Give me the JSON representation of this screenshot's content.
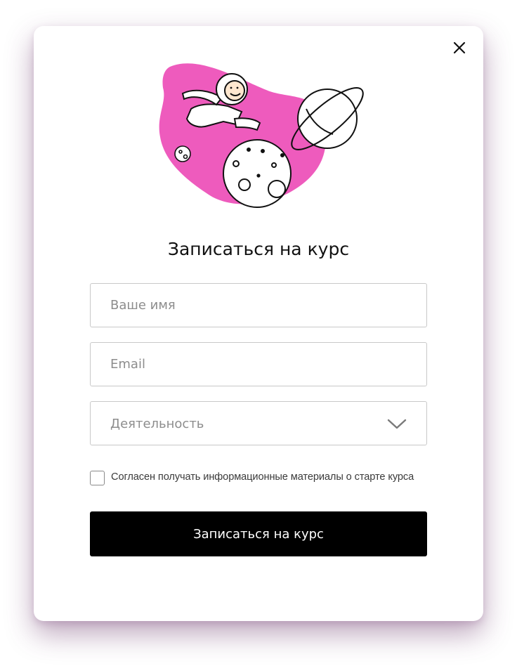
{
  "modal": {
    "close_icon": "close-icon",
    "illustration": "astronaut-planets-illustration",
    "title": "Записаться на курс"
  },
  "form": {
    "name_placeholder": "Ваше имя",
    "email_placeholder": "Email",
    "activity_label": "Деятельность",
    "activity_icon": "chevron-down-icon",
    "consent_text": "Согласен получать информационные материалы о старте курса",
    "submit_label": "Записаться на курс"
  },
  "colors": {
    "accent_pink": "#ee5bbd",
    "button_bg": "#000000",
    "shadow": "#6a2f6a"
  }
}
